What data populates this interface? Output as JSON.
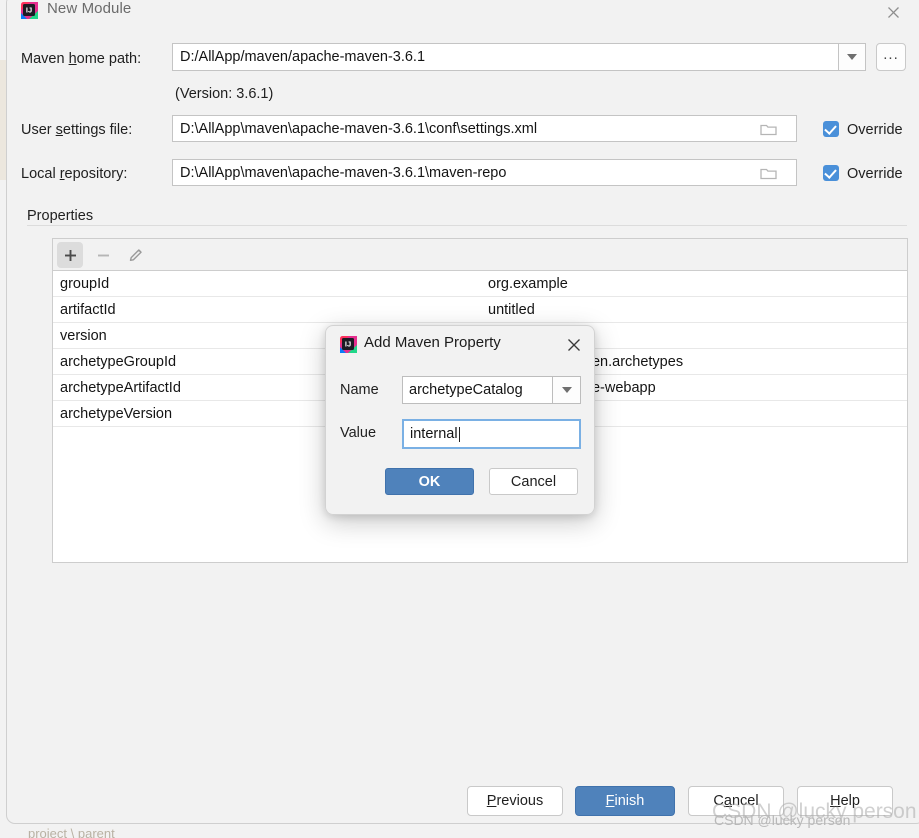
{
  "window": {
    "title": "New Module",
    "icon": "intellij-idea-icon",
    "close_icon": "close-icon"
  },
  "form": {
    "maven_home": {
      "label_pre": "Maven ",
      "label_mnemonic": "h",
      "label_post": "ome path:",
      "value": "D:/AllApp/maven/apache-maven-3.6.1",
      "dropdown_icon": "chevron-down-icon",
      "browse_label": "..."
    },
    "version_note": "(Version: 3.6.1)",
    "user_settings": {
      "label_pre": "User ",
      "label_mnemonic": "s",
      "label_post": "ettings file:",
      "value": "D:\\AllApp\\maven\\apache-maven-3.6.1\\conf\\settings.xml",
      "browse_icon": "folder-icon",
      "override_label": "Override",
      "override_checked": true
    },
    "local_repository": {
      "label_pre": "Local ",
      "label_mnemonic": "r",
      "label_post": "epository:",
      "value": "D:\\AllApp\\maven\\apache-maven-3.6.1\\maven-repo",
      "browse_icon": "folder-icon",
      "override_label": "Override",
      "override_checked": true
    }
  },
  "properties": {
    "group_title": "Properties",
    "toolbar": {
      "add_label": "+",
      "remove_label": "−",
      "edit_icon": "pencil-icon"
    },
    "rows": [
      {
        "key": "groupId",
        "value": "org.example"
      },
      {
        "key": "artifactId",
        "value": "untitled"
      },
      {
        "key": "version",
        "value": ""
      },
      {
        "key": "archetypeGroupId",
        "value": "org.apache.maven.archetypes"
      },
      {
        "key": "archetypeArtifactId",
        "value": "maven-archetype-webapp"
      },
      {
        "key": "archetypeVersion",
        "value": ""
      }
    ]
  },
  "footer": {
    "previous": {
      "pre": "",
      "mnemonic": "P",
      "post": "revious"
    },
    "finish": {
      "pre": "",
      "mnemonic": "F",
      "post": "inish"
    },
    "cancel": {
      "pre": "C",
      "mnemonic": "a",
      "post": "ncel"
    },
    "help": {
      "pre": "",
      "mnemonic": "H",
      "post": "elp"
    }
  },
  "modal": {
    "icon": "intellij-idea-icon",
    "title": "Add Maven Property",
    "close_icon": "close-icon",
    "name_label": "Name",
    "name_value": "archetypeCatalog",
    "name_dropdown_icon": "chevron-down-icon",
    "value_label": "Value",
    "value_value": "internal",
    "ok_label": "OK",
    "cancel_label": "Cancel"
  },
  "background": {
    "breadcrumb": "project     \\     parent"
  },
  "watermark": {
    "text": "CSDN @lucky person"
  },
  "colors": {
    "accent_blue": "#4f82bb",
    "checkbox_blue": "#4a90d9",
    "window_bg": "#f2f2f2",
    "field_bg": "#ffffff"
  }
}
